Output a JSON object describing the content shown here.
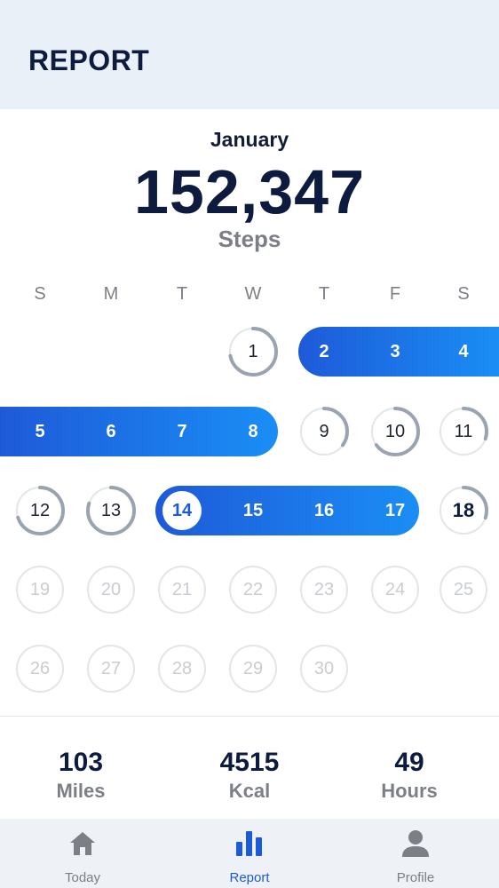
{
  "header": {
    "title": "REPORT"
  },
  "summary": {
    "month": "January",
    "steps": "152,347",
    "steps_label": "Steps"
  },
  "weekdays": [
    "S",
    "M",
    "T",
    "W",
    "T",
    "F",
    "S"
  ],
  "days": [
    {
      "num": "1",
      "state": "progress",
      "progress": 0.72
    },
    {
      "num": "2",
      "state": "goal"
    },
    {
      "num": "3",
      "state": "goal"
    },
    {
      "num": "4",
      "state": "goal"
    },
    {
      "num": "5",
      "state": "goal"
    },
    {
      "num": "6",
      "state": "goal"
    },
    {
      "num": "7",
      "state": "goal"
    },
    {
      "num": "8",
      "state": "goal"
    },
    {
      "num": "9",
      "state": "progress",
      "progress": 0.35
    },
    {
      "num": "10",
      "state": "progress",
      "progress": 0.65
    },
    {
      "num": "11",
      "state": "progress",
      "progress": 0.3
    },
    {
      "num": "12",
      "state": "progress",
      "progress": 0.7
    },
    {
      "num": "13",
      "state": "progress",
      "progress": 0.8
    },
    {
      "num": "14",
      "state": "today"
    },
    {
      "num": "15",
      "state": "goal"
    },
    {
      "num": "16",
      "state": "goal"
    },
    {
      "num": "17",
      "state": "goal"
    },
    {
      "num": "18",
      "state": "progress",
      "progress": 0.3
    },
    {
      "num": "19",
      "state": "future"
    },
    {
      "num": "20",
      "state": "future"
    },
    {
      "num": "21",
      "state": "future"
    },
    {
      "num": "22",
      "state": "future"
    },
    {
      "num": "23",
      "state": "future"
    },
    {
      "num": "24",
      "state": "future"
    },
    {
      "num": "25",
      "state": "future"
    },
    {
      "num": "26",
      "state": "future"
    },
    {
      "num": "27",
      "state": "future"
    },
    {
      "num": "28",
      "state": "future"
    },
    {
      "num": "29",
      "state": "future"
    },
    {
      "num": "30",
      "state": "future"
    }
  ],
  "stats": [
    {
      "value": "103",
      "label": "Miles"
    },
    {
      "value": "4515",
      "label": "Kcal"
    },
    {
      "value": "49",
      "label": "Hours"
    }
  ],
  "nav": [
    {
      "label": "Today",
      "icon": "home-icon",
      "active": false
    },
    {
      "label": "Report",
      "icon": "bar-chart-icon",
      "active": true
    },
    {
      "label": "Profile",
      "icon": "person-icon",
      "active": false
    }
  ],
  "colors": {
    "accent": "#1c5bd8",
    "gradient_start": "#1e5ad8",
    "gradient_end": "#1a8ef5",
    "ring_track": "#e3e5e9",
    "ring_progress": "#9aa3b0"
  }
}
